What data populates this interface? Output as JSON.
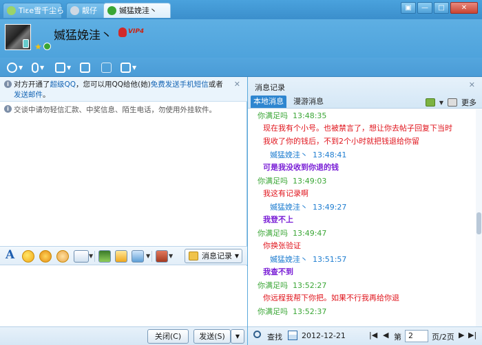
{
  "tabs": [
    {
      "label": "Tiεe雪千尘ら",
      "active": false
    },
    {
      "label": "靓仔",
      "active": false
    },
    {
      "label": "媙猛娩洼丶",
      "active": true
    }
  ],
  "header": {
    "nickname": "媙猛娩洼丶",
    "vip_text": "VIP4"
  },
  "left": {
    "notice1_a": "对方开通了",
    "notice1_link1": "超级QQ",
    "notice1_b": "，您可以用QQ给他(她)",
    "notice1_link2": "免费发送手机短信",
    "notice1_c": "或者",
    "notice1_link3": "发送邮件",
    "notice1_d": "。",
    "notice2": "交谈中请勿轻信汇款、中奖信息、陌生电话，勿使用外挂软件。",
    "msg_record_label": "消息记录",
    "close_label": "关闭(C)",
    "send_label": "发送(S)"
  },
  "right": {
    "title": "消息记录",
    "tab_local": "本地消息",
    "tab_roam": "漫游消息",
    "more": "更多",
    "messages": [
      {
        "sender": "你满足吗",
        "time": "13:48:35",
        "side": "other",
        "lines": [
          "现在我有个小号。也被禁言了，想让你去帖子回复下当时",
          "我收了你的钱后，不到2个小时就把钱退给你留"
        ],
        "style": "red"
      },
      {
        "sender": "媙猛娩洼丶",
        "time": "13:48:41",
        "side": "self",
        "lines": [
          "可是我没收到你退的钱"
        ],
        "style": "purple"
      },
      {
        "sender": "你满足吗",
        "time": "13:49:03",
        "side": "other",
        "lines": [
          "我这有记录啊"
        ],
        "style": "red"
      },
      {
        "sender": "媙猛娩洼丶",
        "time": "13:49:27",
        "side": "self",
        "lines": [
          "我登不上"
        ],
        "style": "purple"
      },
      {
        "sender": "你满足吗",
        "time": "13:49:47",
        "side": "other",
        "lines": [
          "你换张验证"
        ],
        "style": "red"
      },
      {
        "sender": "媙猛娩洼丶",
        "time": "13:51:57",
        "side": "self",
        "lines": [
          "我查不到"
        ],
        "style": "purple"
      },
      {
        "sender": "你满足吗",
        "time": "13:52:27",
        "side": "other",
        "lines": [
          "你远程我帮下你把。如果不行我再给你退"
        ],
        "style": "red"
      },
      {
        "sender": "你满足吗",
        "time": "13:52:37",
        "side": "other",
        "lines": [],
        "style": "red"
      }
    ],
    "search_label": "查找",
    "date": "2012-12-21",
    "page_prefix": "第",
    "page_value": "2",
    "page_suffix": "页/2页"
  }
}
